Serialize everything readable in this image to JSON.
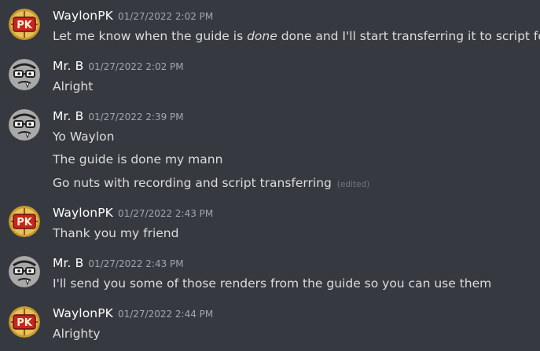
{
  "messages": [
    {
      "author": "WaylonPK",
      "timestamp": "01/27/2022 2:02 PM",
      "avatar": "pk-logo-avatar",
      "lines": [
        {
          "pre": "Let me know when the guide is ",
          "em": "done",
          "post": " done and I'll start transferring it to script form"
        }
      ]
    },
    {
      "author": "Mr. B",
      "timestamp": "01/27/2022 2:02 PM",
      "avatar": "cartoon-face-avatar",
      "lines": [
        {
          "text": "Alright"
        }
      ]
    },
    {
      "author": "Mr. B",
      "timestamp": "01/27/2022 2:39 PM",
      "avatar": "cartoon-face-avatar",
      "lines": [
        {
          "text": "Yo Waylon"
        },
        {
          "text": "The guide is done my mann"
        },
        {
          "text": "Go nuts with recording and script transferring",
          "edited": "(edited)"
        }
      ]
    },
    {
      "author": "WaylonPK",
      "timestamp": "01/27/2022 2:43 PM",
      "avatar": "pk-logo-avatar",
      "lines": [
        {
          "text": "Thank you my friend"
        }
      ]
    },
    {
      "author": "Mr. B",
      "timestamp": "01/27/2022 2:43 PM",
      "avatar": "cartoon-face-avatar",
      "lines": [
        {
          "text": "I'll send you some of those renders from the guide so you can use them"
        }
      ]
    },
    {
      "author": "WaylonPK",
      "timestamp": "01/27/2022 2:44 PM",
      "avatar": "pk-logo-avatar",
      "lines": [
        {
          "text": "Alrighty"
        }
      ]
    }
  ],
  "colors": {
    "background": "#36393f",
    "username": "#ffffff",
    "timestamp": "#a3a6aa",
    "message_text": "#dcddde",
    "edited": "#72767d"
  }
}
